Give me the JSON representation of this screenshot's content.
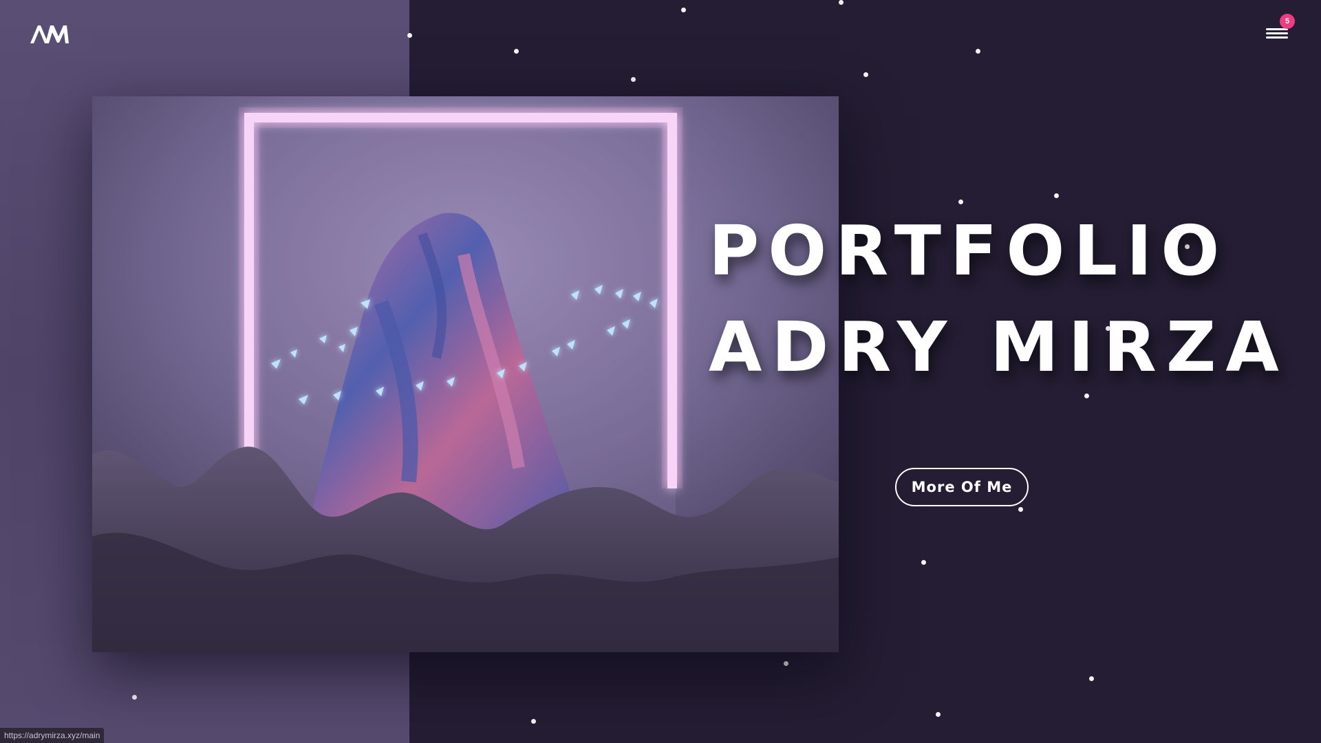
{
  "header": {
    "logo": {
      "icon": "am-monogram-logo",
      "text": "AM"
    },
    "menu": {
      "icon": "hamburger-menu-icon",
      "badge_count": "5"
    }
  },
  "hero": {
    "title_line1": "PORTFOLIO",
    "title_line2": "ADRY MIRZA",
    "cta_label": "More Of Me",
    "image": {
      "subject": "neon-frame-draped-figure-render"
    }
  },
  "status_bar": {
    "url": "https://adrymirza.xyz/main"
  },
  "colors": {
    "left_panel": "#564a6f",
    "background": "#241d33",
    "badge": "#ef3b80",
    "text": "#ffffff"
  }
}
